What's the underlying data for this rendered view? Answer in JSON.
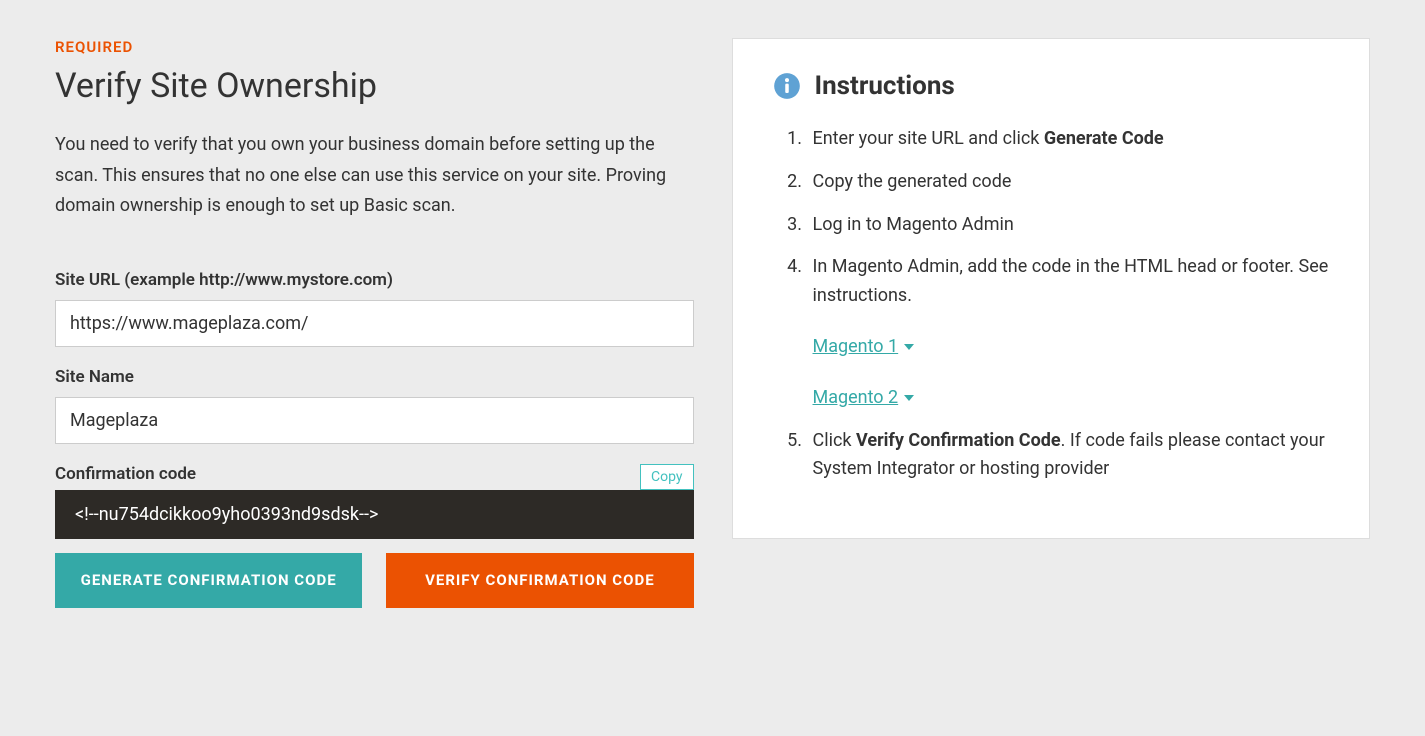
{
  "left": {
    "required_tag": "REQUIRED",
    "title": "Verify Site Ownership",
    "description": "You need to verify that you own your business domain before setting up the scan. This ensures that no one else can use this service on your site. Proving domain ownership is enough to set up Basic scan.",
    "site_url_label": "Site URL (example http://www.mystore.com)",
    "site_url_value": "https://www.mageplaza.com/",
    "site_name_label": "Site Name",
    "site_name_value": "Mageplaza",
    "confirmation_label": "Confirmation code",
    "copy_label": "Copy",
    "confirmation_code": "<!--nu754dcikkoo9yho0393nd9sdsk-->",
    "generate_btn": "GENERATE CONFIRMATION CODE",
    "verify_btn": "VERIFY CONFIRMATION CODE"
  },
  "right": {
    "title": "Instructions",
    "steps": {
      "s1a": "Enter your site URL and click ",
      "s1b": "Generate Code",
      "s2": "Copy the generated code",
      "s3": "Log in to Magento Admin",
      "s4": "In Magento Admin, add the code in the HTML head or footer. See instructions.",
      "s4_link1": "Magento 1",
      "s4_link2": "Magento 2",
      "s5a": "Click ",
      "s5b": "Verify Confirmation Code",
      "s5c": ". If code fails please contact your System Integrator or hosting provider"
    }
  }
}
